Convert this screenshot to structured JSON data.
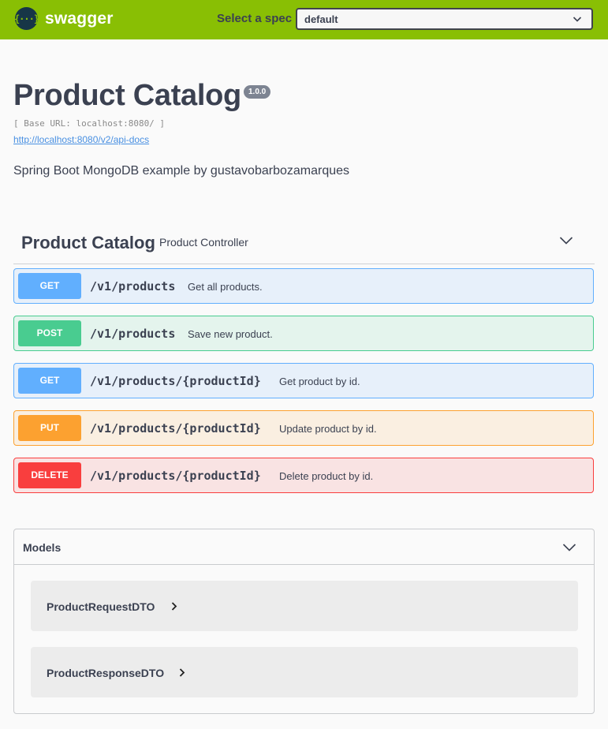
{
  "topbar": {
    "logo_glyph": "{···}",
    "brand": "swagger",
    "spec_label": "Select a spec",
    "spec_value": "default",
    "colors": {
      "bar": "#89bf04",
      "logo_bg": "#173647"
    }
  },
  "info": {
    "title": "Product Catalog",
    "version": "1.0.0",
    "base_url": "[ Base URL: localhost:8080/ ]",
    "docs_link": "http://localhost:8080/v2/api-docs",
    "description": "Spring Boot MongoDB example by gustavobarbozamarques"
  },
  "tag": {
    "name": "Product Catalog",
    "description": "Product Controller",
    "toggle_icon": "chevron-down-icon"
  },
  "operations": [
    {
      "method": "GET",
      "path": "/v1/products",
      "summary": "Get all products.",
      "color": "#61affe"
    },
    {
      "method": "POST",
      "path": "/v1/products",
      "summary": "Save new product.",
      "color": "#49cc90"
    },
    {
      "method": "GET",
      "path": "/v1/products/{productId}",
      "summary": "Get product by id.",
      "color": "#61affe"
    },
    {
      "method": "PUT",
      "path": "/v1/products/{productId}",
      "summary": "Update product by id.",
      "color": "#fca130"
    },
    {
      "method": "DELETE",
      "path": "/v1/products/{productId}",
      "summary": "Delete product by id.",
      "color": "#f93e3e"
    }
  ],
  "models": {
    "title": "Models",
    "toggle_icon": "chevron-down-icon",
    "items": [
      {
        "name": "ProductRequestDTO",
        "expand_icon": "chevron-right-icon"
      },
      {
        "name": "ProductResponseDTO",
        "expand_icon": "chevron-right-icon"
      }
    ]
  }
}
